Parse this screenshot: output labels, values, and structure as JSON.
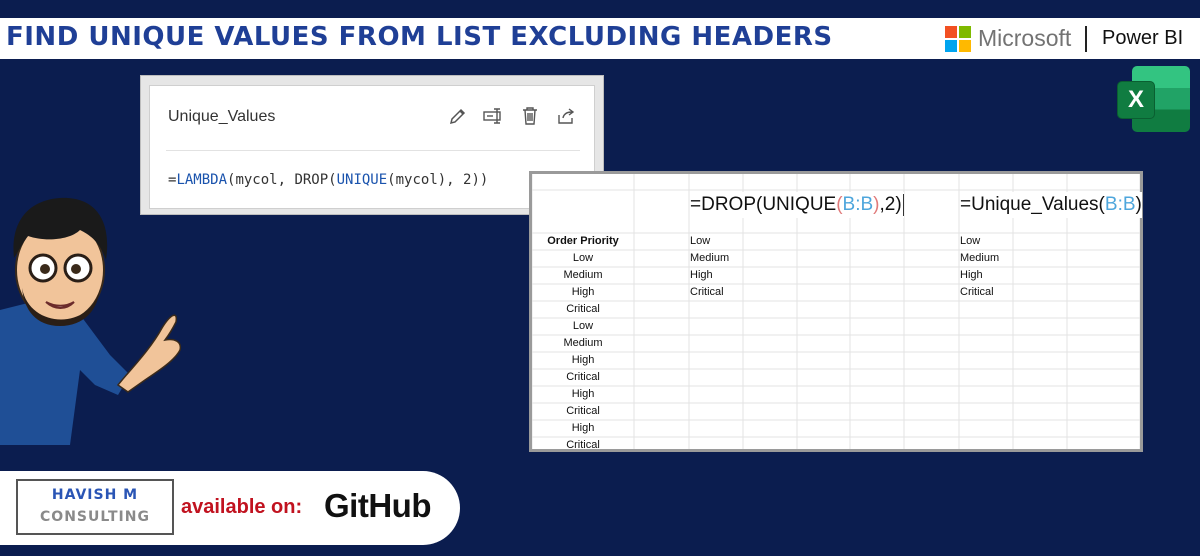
{
  "header": {
    "title": "FIND UNIQUE VALUES FROM LIST EXCLUDING HEADERS",
    "brand_microsoft": "Microsoft",
    "brand_powerbi": "Power BI"
  },
  "excel_icon_letter": "X",
  "name_manager": {
    "name": "Unique_Values",
    "formula": {
      "prefix": "=",
      "lambda": "LAMBDA",
      "part1": "(mycol, DROP(",
      "unique": "UNIQUE",
      "part2": "(mycol), 2))"
    },
    "icons": [
      "edit-pencil-icon",
      "rename-icon",
      "delete-trash-icon",
      "share-icon"
    ]
  },
  "spreadsheet": {
    "formula_drop": {
      "text_before": "=DROP(UNIQUE",
      "paren_open": "(",
      "ref": "B:B",
      "paren_close": ")",
      "text_after": ",2)"
    },
    "formula_unique_values": {
      "text_before": "=Unique_Values(",
      "ref": "B:B",
      "text_after": ")"
    },
    "column_b": [
      "Order Priority",
      "Low",
      "Medium",
      "High",
      "Critical",
      "Low",
      "Medium",
      "High",
      "Critical",
      "High",
      "Critical",
      "High",
      "Critical"
    ],
    "drop_result": [
      "Low",
      "Medium",
      "High",
      "Critical"
    ],
    "unique_values_result": [
      "Low",
      "Medium",
      "High",
      "Critical"
    ]
  },
  "footer": {
    "consulting_name": "HAVISH M",
    "consulting_sub": "CONSULTING",
    "available_on": "available on:",
    "github": "GitHub"
  },
  "colors": {
    "background": "#0b1d4f",
    "title": "#1f3f96",
    "excel_green": "#107c41",
    "formula_keyword": "#1a53ad",
    "reference_blue": "#4ea6dc",
    "available_red": "#c1121f"
  }
}
